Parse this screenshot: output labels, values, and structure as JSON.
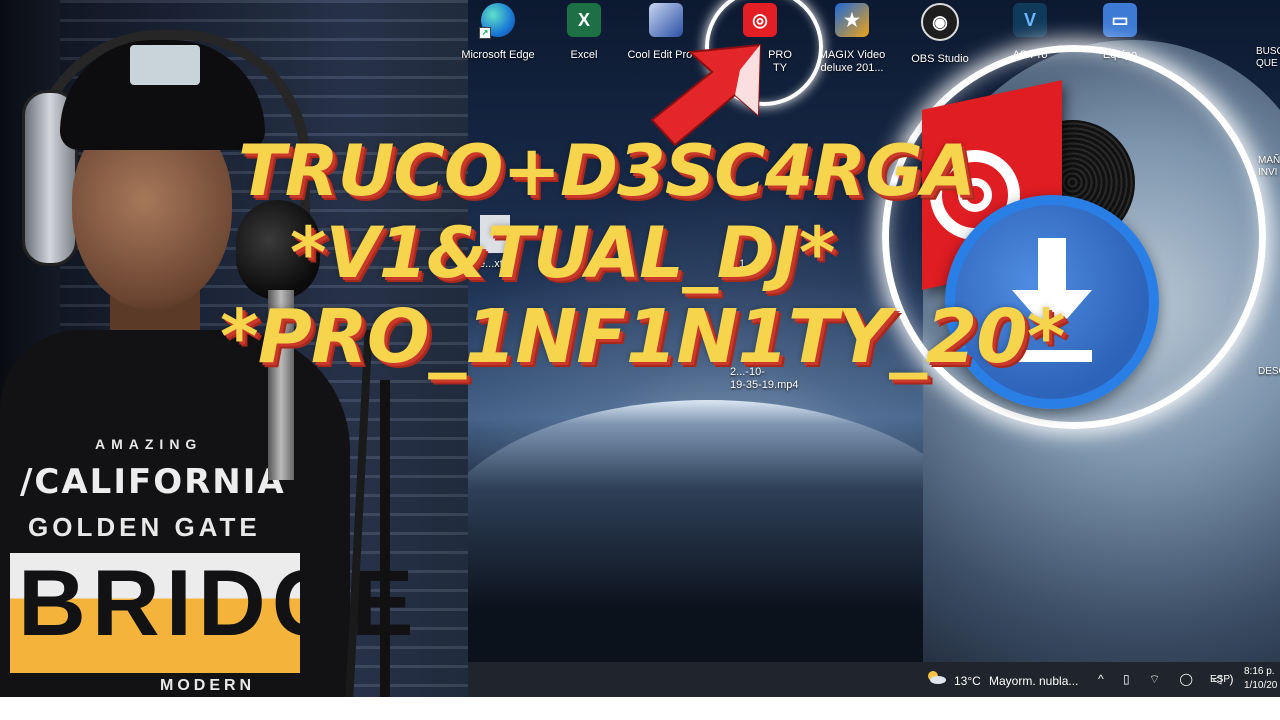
{
  "desktop_icons": [
    {
      "id": "edge",
      "label": "Microsoft Edge",
      "icon": "edge-icon"
    },
    {
      "id": "excel",
      "label": "Excel",
      "icon": "excel-icon",
      "glyph": "X"
    },
    {
      "id": "cooledit",
      "label": "Cool Edit Pro ...",
      "icon": "cool-edit-pro-icon"
    },
    {
      "id": "vdj",
      "label": "PRO\nTY",
      "icon": "virtual-dj-icon"
    },
    {
      "id": "magix",
      "label": "MAGIX Video\ndeluxe 201...",
      "icon": "magix-video-icon"
    },
    {
      "id": "obs",
      "label": "OBS Studio",
      "icon": "obs-studio-icon"
    },
    {
      "id": "vegas",
      "label": "AS Pro",
      "icon": "vegas-pro-icon",
      "glyph": "V"
    },
    {
      "id": "equipo",
      "label": "Equipo",
      "icon": "computer-icon"
    }
  ],
  "desktop_files": {
    "file1": "l tie...xt",
    "file1_suffix": "01",
    "file2": "2...-10-\n19-35-19.mp4",
    "right1": "BUSC\nQUE",
    "right2": "MAÑ\nINVI",
    "right3": "DESC"
  },
  "headline": {
    "line1": "TRUCO+D3SC4RGA",
    "line2": "*V1&TUAL_DJ*",
    "line3": "*PRO_1NF1N1TY_20*"
  },
  "shirt": {
    "line1": "AMAZING",
    "line2": "/CALIFORNIA",
    "line3": "GOLDEN GATE",
    "line4": "BRIDGE",
    "line5": "MODERN"
  },
  "taskbar": {
    "temperature": "13°C",
    "weather": "Mayorm. nubla...",
    "language": "ESP",
    "time": "8:16 p.\n1/10/20"
  },
  "colors": {
    "headline": "#f6d44c",
    "headline_shadow": "#c9382a",
    "vdj_red": "#e01d23",
    "download_blue": "#2d63b8"
  }
}
